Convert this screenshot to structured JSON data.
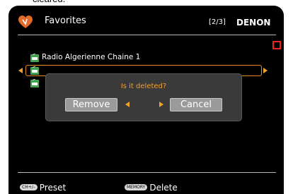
{
  "header": {
    "title": "Favorites",
    "page_indicator": "[2/3]",
    "brand": "DENON",
    "heart_icon": "heart-icon"
  },
  "list": {
    "items": [
      {
        "label": "Radio Algerienne Chaine 1",
        "icon": "radio-station-icon"
      },
      {
        "label": "",
        "icon": "radio-station-icon",
        "selected": true
      },
      {
        "label": "",
        "icon": "radio-station-icon"
      }
    ]
  },
  "dialog": {
    "question": "Is it deleted?",
    "remove_label": "Remove",
    "cancel_label": "Cancel"
  },
  "footer": {
    "preset_key": "CH+/–",
    "preset_label": "Preset",
    "delete_key": "MEMORY",
    "delete_label": "Delete"
  },
  "colors": {
    "accent": "#f0a030",
    "indicator_red": "#e8241c",
    "background": "#000000",
    "dialog_bg": "#3a3a3a",
    "button_gray": "#9a9a9a"
  }
}
